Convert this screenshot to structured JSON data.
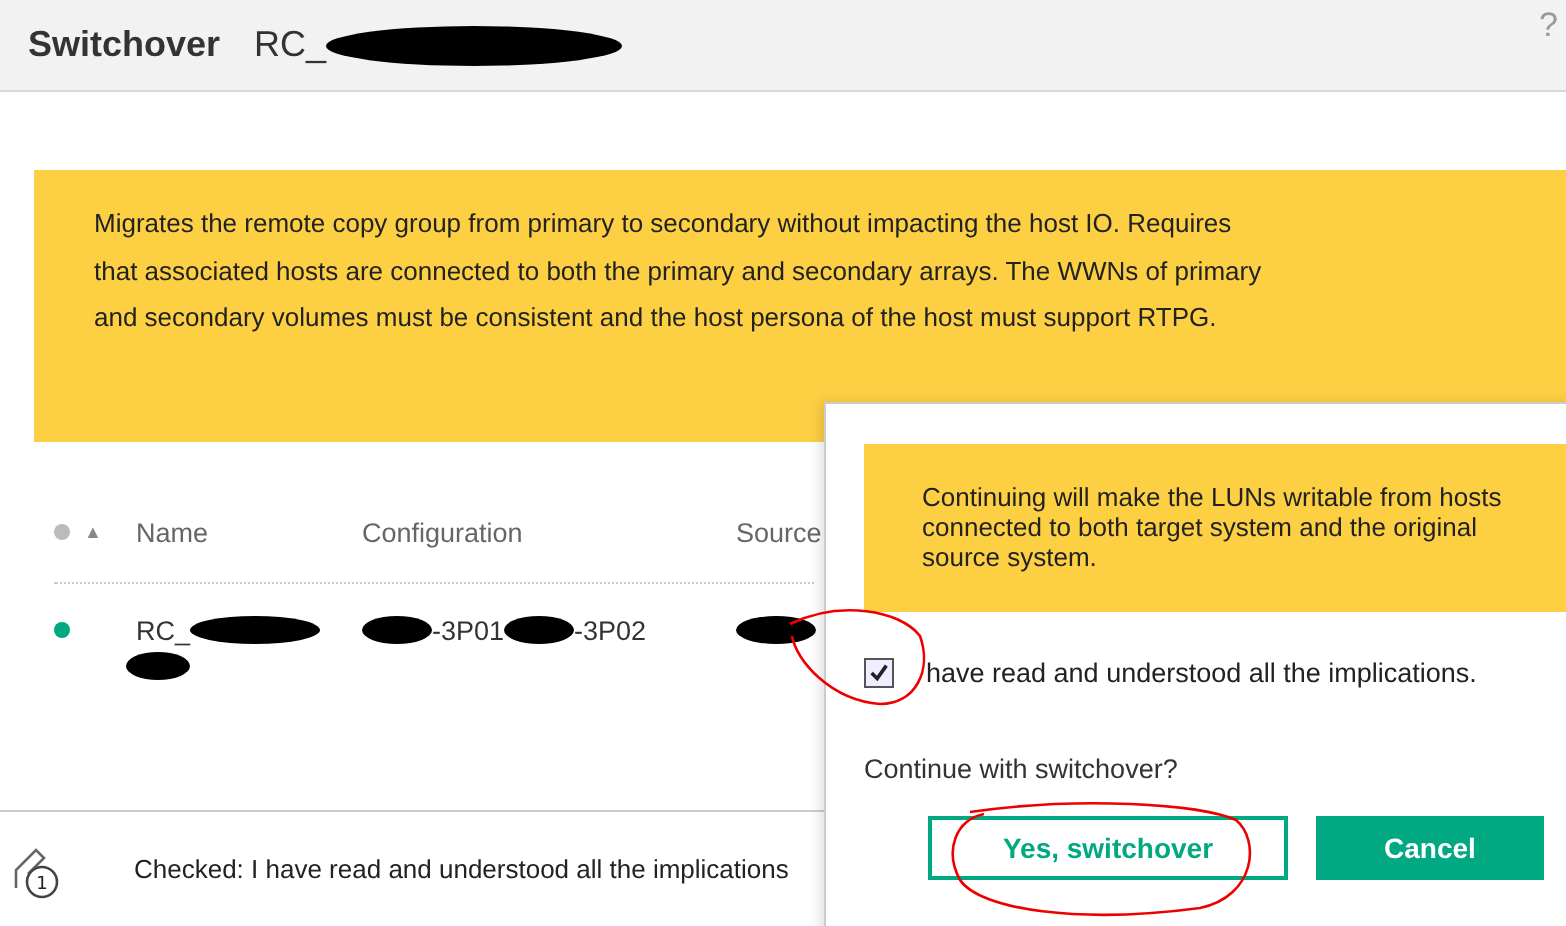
{
  "dialog": {
    "title": "Switchover",
    "subtitle": "RC_",
    "help": "?"
  },
  "info": "Migrates the remote copy group from primary to secondary without impacting the host IO. Requires that associated hosts are connected to both the primary and secondary arrays. The WWNs of primary and secondary volumes must be consistent and the host persona of the host must support RTPG.",
  "table": {
    "sort_icon": "▲",
    "columns": [
      "Name",
      "Configuration",
      "Source"
    ],
    "rows": [
      {
        "color": "#01a982",
        "name": "RC_",
        "configuration": [
          "-3P01",
          "-3P02"
        ]
      }
    ]
  },
  "footer": {
    "badge": "1",
    "text": "Checked: I have read and understood all the implications"
  },
  "confirm": {
    "warning": "Continuing will make the LUNs writable from hosts connected to both target system and the original source system.",
    "checkbox": {
      "label": "have read and understood all the implications.",
      "checked": true
    },
    "question": "Continue with switchover?",
    "buttons": [
      {
        "label": "Yes, switchover",
        "kind": "secondary"
      },
      {
        "label": "Cancel",
        "kind": "primary"
      }
    ]
  }
}
